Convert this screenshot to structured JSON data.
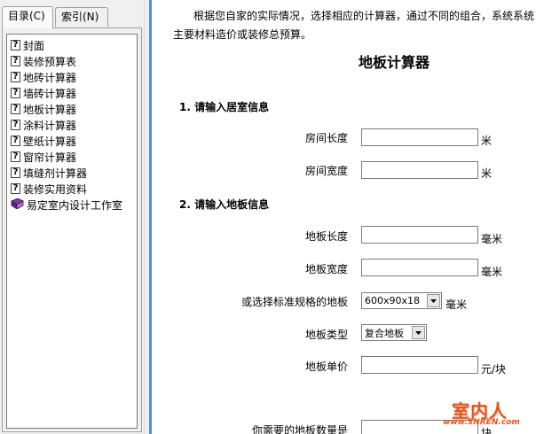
{
  "tabs": [
    {
      "label": "目录(C)"
    },
    {
      "label": "索引(N)"
    }
  ],
  "toc": {
    "items": [
      {
        "label": "封面",
        "icon": "help-page-icon"
      },
      {
        "label": "装修预算表",
        "icon": "help-page-icon"
      },
      {
        "label": "地砖计算器",
        "icon": "help-page-icon"
      },
      {
        "label": "墙砖计算器",
        "icon": "help-page-icon"
      },
      {
        "label": "地板计算器",
        "icon": "help-page-icon"
      },
      {
        "label": "涂料计算器",
        "icon": "help-page-icon"
      },
      {
        "label": "壁纸计算器",
        "icon": "help-page-icon"
      },
      {
        "label": "窗帘计算器",
        "icon": "help-page-icon"
      },
      {
        "label": "填缝剂计算器",
        "icon": "help-page-icon"
      },
      {
        "label": "装修实用资料",
        "icon": "help-page-icon"
      },
      {
        "label": "易定室内设计工作室",
        "icon": "book-icon"
      }
    ]
  },
  "content": {
    "intro_line1": "根据您自家的实际情况，选择相应的计算器，通过不同的组合，系统系统",
    "intro_line2": "主要材料造价或装修总预算。",
    "title": "地板计算器",
    "section1": "1. 请输入居室信息",
    "room_length_label": "房间长度",
    "room_length_unit": "米",
    "room_width_label": "房间宽度",
    "room_width_unit": "米",
    "section2": "2. 请输入地板信息",
    "floor_length_label": "地板长度",
    "floor_length_unit": "毫米",
    "floor_width_label": "地板宽度",
    "floor_width_unit": "毫米",
    "std_spec_label": "或选择标准规格的地板",
    "std_spec_value": "600x90x18",
    "std_spec_unit": "毫米",
    "floor_type_label": "地板类型",
    "floor_type_value": "复合地板",
    "unit_price_label": "地板单价",
    "unit_price_unit": "元/块",
    "quantity_label": "你需要的地板数量是",
    "quantity_unit": "块"
  },
  "watermark": {
    "text": "室内人",
    "url": "www.SNREN.com"
  },
  "colors": {
    "splitter_accent": "#4a90e2",
    "watermark": "#e8541a"
  }
}
